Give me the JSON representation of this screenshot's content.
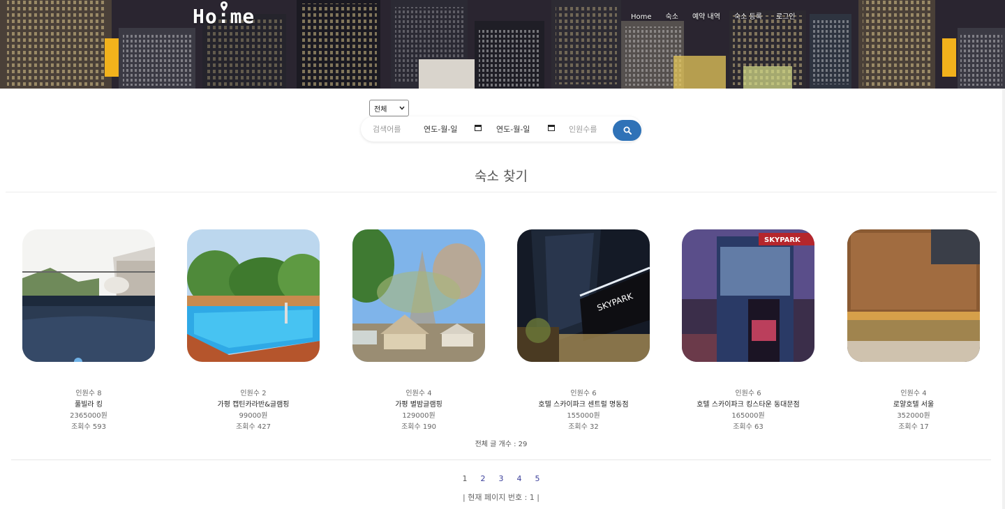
{
  "header": {
    "logo": "Ho:me",
    "nav": [
      "Home",
      "숙소",
      "예약 내역",
      "숙소 등록",
      "로그인"
    ]
  },
  "search": {
    "category_selected": "전체",
    "keyword_placeholder": "검색어를",
    "checkin_value": "연도-월-일",
    "checkout_value": "연도-월-일",
    "guests_placeholder": "인원수를"
  },
  "main": {
    "title": "숙소 찾기",
    "total_label": "전체 글 개수 : 29",
    "pages": [
      "1",
      "2",
      "3",
      "4",
      "5"
    ],
    "current_page_label": "| 현재 페이지 번호 : 1 |"
  },
  "cards": [
    {
      "guests": "인원수 8",
      "name": "풀빌라 킹",
      "price": "2365000원",
      "views": "조회수 593"
    },
    {
      "guests": "인원수 2",
      "name": "가평 캡틴카라반&글램핑",
      "price": "99000원",
      "views": "조회수 427"
    },
    {
      "guests": "인원수 4",
      "name": "가평 별밤글램핑",
      "price": "129000원",
      "views": "조회수 190"
    },
    {
      "guests": "인원수 6",
      "name": "호텔 스카이파크 센트럴 명동점",
      "price": "155000원",
      "views": "조회수 32"
    },
    {
      "guests": "인원수 6",
      "name": "호텔 스카이파크 킹스타운 동대문점",
      "price": "165000원",
      "views": "조회수 63"
    },
    {
      "guests": "인원수 4",
      "name": "로얄호텔 서울",
      "price": "352000원",
      "views": "조회수 17"
    }
  ],
  "images": {
    "card1_sign": "",
    "card4_sign": "SKYPARK",
    "card5_sign": "SKYPARK"
  }
}
